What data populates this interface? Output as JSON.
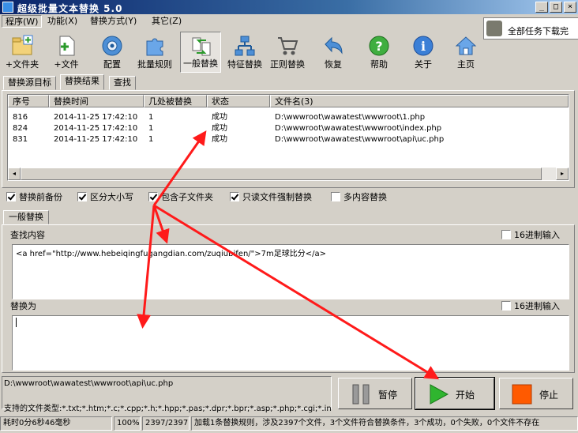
{
  "window": {
    "title": "超级批量文本替换 5.0",
    "minimize_glyph": "_",
    "maximize_glyph": "□",
    "close_glyph": "×"
  },
  "menu": {
    "items": [
      "程序(W)",
      "功能(X)",
      "替换方式(Y)",
      "其它(Z)"
    ]
  },
  "notification": {
    "text": "全部任务下载完"
  },
  "toolbar": {
    "buttons": [
      {
        "label": "+文件夹",
        "icon": "add-folder-icon"
      },
      {
        "label": "+文件",
        "icon": "add-file-icon"
      },
      {
        "label": "配置",
        "icon": "settings-icon"
      },
      {
        "label": "批量规则",
        "icon": "puzzle-icon"
      },
      {
        "label": "一般替换",
        "icon": "general-replace-icon"
      },
      {
        "label": "特征替换",
        "icon": "network-icon"
      },
      {
        "label": "正则替换",
        "icon": "cart-icon"
      },
      {
        "label": "恢复",
        "icon": "undo-arrow-icon"
      },
      {
        "label": "帮助",
        "icon": "help-icon"
      },
      {
        "label": "关于",
        "icon": "info-icon"
      },
      {
        "label": "主页",
        "icon": "home-icon"
      }
    ]
  },
  "top_tabs": [
    "替换源目标",
    "替换结果",
    "查找"
  ],
  "results": {
    "columns": [
      "序号",
      "替换时间",
      "几处被替换",
      "状态",
      "文件名(3)"
    ],
    "rows": [
      [
        "816",
        "2014-11-25 17:42:10",
        "1",
        "成功",
        "D:\\wwwroot\\wawatest\\wwwroot\\1.php"
      ],
      [
        "824",
        "2014-11-25 17:42:10",
        "1",
        "成功",
        "D:\\wwwroot\\wawatest\\wwwroot\\index.php"
      ],
      [
        "831",
        "2014-11-25 17:42:10",
        "1",
        "成功",
        "D:\\wwwroot\\wawatest\\wwwroot\\api\\uc.php"
      ]
    ],
    "scroll_left_glyph": "◂",
    "scroll_right_glyph": "▸"
  },
  "options": [
    {
      "label": "替换前备份",
      "checked": true
    },
    {
      "label": "区分大小写",
      "checked": true
    },
    {
      "label": "包含子文件夹",
      "checked": true
    },
    {
      "label": "只读文件强制替换",
      "checked": true
    },
    {
      "label": "多内容替换",
      "checked": false
    }
  ],
  "replace_tab": "一般替换",
  "find": {
    "label": "查找内容",
    "hex_label": "16进制输入",
    "value": "<a href=\"http://www.hebeiqingfugangdian.com/zuqiubifen/\">7m足球比分</a>"
  },
  "replace": {
    "label": "替换为",
    "hex_label": "16进制输入",
    "value": ""
  },
  "current_path": "D:\\wwwroot\\wawatest\\wwwroot\\api\\uc.php",
  "file_types": "支持的文件类型:*.txt;*.htm;*.c;*.cpp;*.h;*.hpp;*.pas;*.dpr;*.bpr;*.asp;*.php;*.cgi;*.ini;*.ba",
  "actions": {
    "pause": "暂停",
    "start": "开始",
    "stop": "停止"
  },
  "status": {
    "elapsed": "耗时0分6秒46毫秒",
    "percent": "100%",
    "count": "2397/2397",
    "message": "加载1条替换规则，涉及2397个文件，3个文件符合替换条件，3个成功，0个失败，0个文件不存在"
  },
  "colors": {
    "annotation_arrow": "#ff1a1a",
    "title_bar": "#0a246a",
    "start_green": "#2fb52f",
    "stop_orange": "#ff5a00"
  }
}
